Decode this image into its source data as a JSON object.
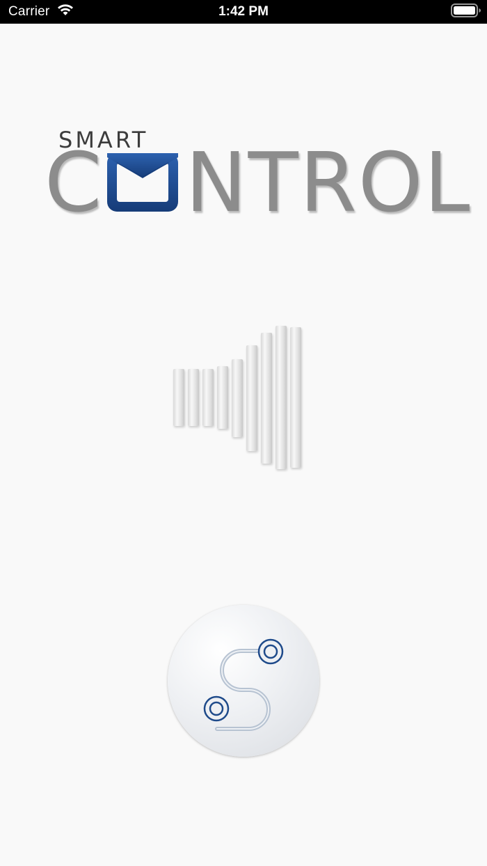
{
  "status_bar": {
    "carrier": "Carrier",
    "time": "1:42 PM",
    "icons": [
      "wifi-icon",
      "battery-icon"
    ]
  },
  "logo": {
    "small_text": "SMART",
    "big_text_first": "C",
    "big_text_rest": "NTROL",
    "colors": {
      "text_gray": "#8c8c8c",
      "brand_blue": "#1e4a8a"
    }
  },
  "graphic": {
    "icon": "sound-bars-icon"
  },
  "connect_button": {
    "icon": "route-connection-icon",
    "colors": {
      "path": "#b7c3d2",
      "node": "#1e4a8a"
    }
  }
}
